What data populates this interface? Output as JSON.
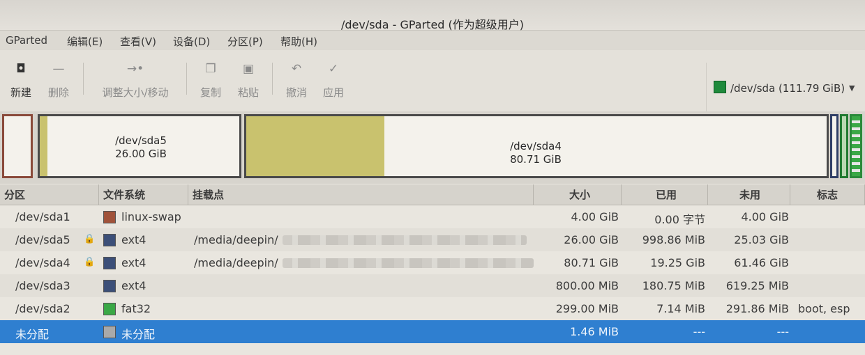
{
  "window": {
    "title": "/dev/sda - GParted (作为超级用户)",
    "controls": [
      "−",
      "□",
      "✕"
    ]
  },
  "menu": [
    "GParted",
    "编辑(E)",
    "查看(V)",
    "设备(D)",
    "分区(P)",
    "帮助(H)"
  ],
  "toolbar": {
    "new": "新建",
    "delete": "删除",
    "resize_move": "调整大小/移动",
    "copy": "复制",
    "paste": "粘贴",
    "undo": "撤消",
    "apply": "应用"
  },
  "device_selector": {
    "label": "/dev/sda",
    "size": "(111.79 GiB)",
    "color": "#1f8a3c"
  },
  "disk_map": {
    "sda5": {
      "name": "/dev/sda5",
      "size": "26.00 GiB",
      "used_fraction": 0.0375
    },
    "sda4": {
      "name": "/dev/sda4",
      "size": "80.71 GiB",
      "used_fraction": 0.2385
    }
  },
  "table": {
    "headers": [
      "分区",
      "文件系统",
      "挂载点",
      "大小",
      "已用",
      "未用",
      "标志"
    ],
    "rows": [
      {
        "partition": "/dev/sda1",
        "locked": false,
        "fs": "linux-swap",
        "fs_color": "#a0523a",
        "mount": "",
        "size": "4.00 GiB",
        "used": "0.00 字节",
        "unused": "4.00 GiB",
        "flags": ""
      },
      {
        "partition": "/dev/sda5",
        "locked": true,
        "fs": "ext4",
        "fs_color": "#3c4f78",
        "mount": "/media/deepin/",
        "size": "26.00 GiB",
        "used": "998.86 MiB",
        "unused": "25.03 GiB",
        "flags": ""
      },
      {
        "partition": "/dev/sda4",
        "locked": true,
        "fs": "ext4",
        "fs_color": "#3c4f78",
        "mount": "/media/deepin/",
        "size": "80.71 GiB",
        "used": "19.25 GiB",
        "unused": "61.46 GiB",
        "flags": ""
      },
      {
        "partition": "/dev/sda3",
        "locked": false,
        "fs": "ext4",
        "fs_color": "#3c4f78",
        "mount": "",
        "size": "800.00 MiB",
        "used": "180.75 MiB",
        "unused": "619.25 MiB",
        "flags": ""
      },
      {
        "partition": "/dev/sda2",
        "locked": false,
        "fs": "fat32",
        "fs_color": "#3aa846",
        "mount": "",
        "size": "299.00 MiB",
        "used": "7.14 MiB",
        "unused": "291.86 MiB",
        "flags": "boot, esp"
      },
      {
        "partition": "未分配",
        "locked": false,
        "fs": "未分配",
        "fs_color": "#a9a9a9",
        "mount": "",
        "size": "1.46 MiB",
        "used": "---",
        "unused": "---",
        "flags": ""
      }
    ]
  }
}
